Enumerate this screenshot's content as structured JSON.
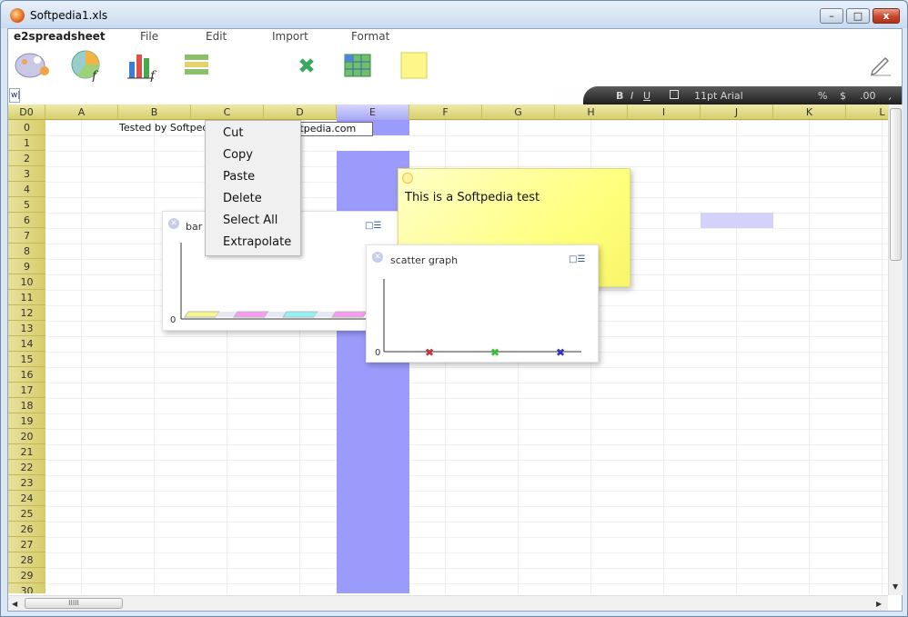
{
  "window": {
    "title": "Softpedia1.xls",
    "minimize": "–",
    "maximize": "□",
    "close": "x"
  },
  "menubar": {
    "brand": "e2spreadsheet",
    "items": [
      "File",
      "Edit",
      "Import",
      "Format"
    ]
  },
  "toolbar": {
    "tools": [
      "palette-icon",
      "pie-chart-function-icon",
      "bar-chart-function-icon",
      "list-icon",
      "chart-icon",
      "table-icon",
      "sticky-note-icon",
      "pencil-icon"
    ]
  },
  "formula_bar": {
    "value": "w|"
  },
  "format_bar": {
    "bold": "B",
    "italic": "I",
    "underline": "U",
    "font": "11pt  Arial",
    "percent": "%",
    "currency": "$",
    "decimals": ".00",
    "comma": ","
  },
  "grid": {
    "corner": "D0",
    "columns": [
      "A",
      "B",
      "C",
      "D",
      "E",
      "F",
      "G",
      "H",
      "I",
      "J",
      "K",
      "L"
    ],
    "rows": [
      "0",
      "1",
      "2",
      "3",
      "4",
      "5",
      "6",
      "7",
      "8",
      "9",
      "10",
      "11",
      "12",
      "13",
      "14",
      "15",
      "16",
      "17",
      "18",
      "19",
      "20",
      "21",
      "22",
      "23",
      "24",
      "25",
      "26",
      "27",
      "28",
      "29",
      "30"
    ],
    "cell_b0": "Tested by Softpedia",
    "cell_d0": "oftpedia.com"
  },
  "context_menu": {
    "items": [
      "Cut",
      "Copy",
      "Paste",
      "Delete",
      "Select All",
      "Extrapolate"
    ]
  },
  "bar_panel": {
    "title": "bar graph",
    "axis_zero": "0",
    "bar_colors": [
      "#f7f78a",
      "#f79cf2",
      "#8cf2f2",
      "#f79cf2"
    ]
  },
  "scatter_panel": {
    "title": "scatter graph",
    "axis_zero": "0",
    "marker": "✖",
    "marker_colors": [
      "#c0303a",
      "#30c030",
      "#3030c0"
    ]
  },
  "note": {
    "text": "This is a Softpedia test"
  },
  "scrollbar": {
    "grip": "IIIII"
  }
}
